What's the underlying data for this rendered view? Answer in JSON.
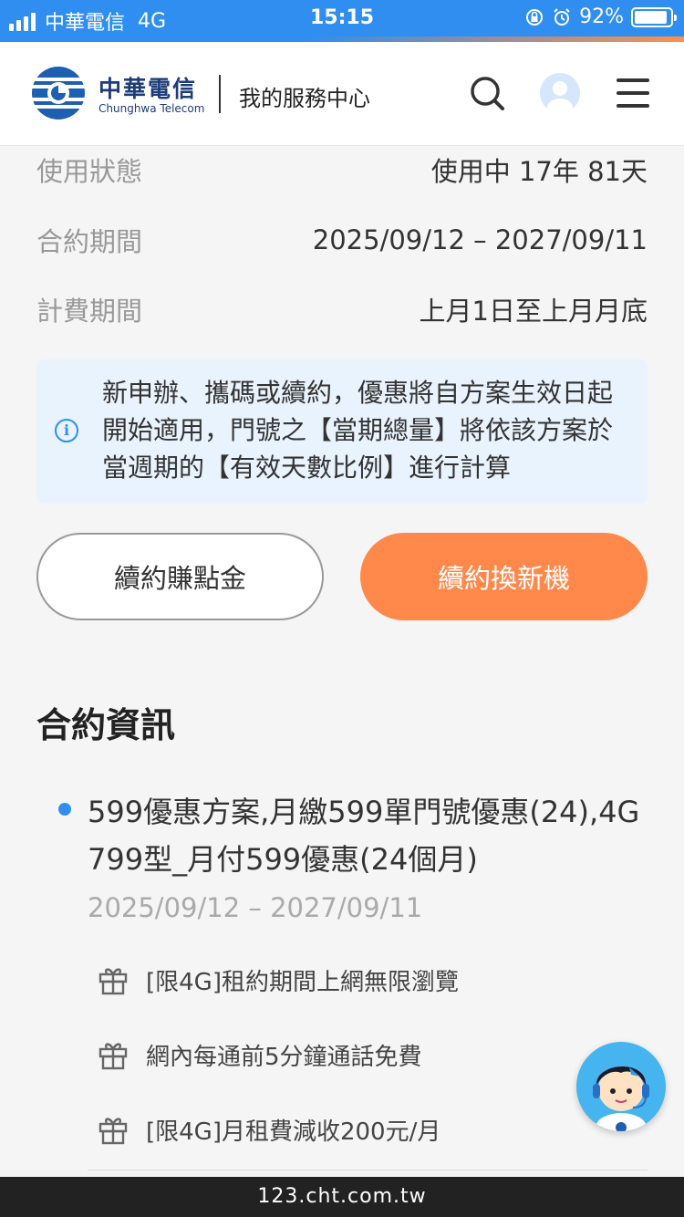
{
  "status_bar": {
    "carrier": "中華電信",
    "network": "4G",
    "time": "15:15",
    "battery": "92%",
    "battery_level": 0.92
  },
  "header": {
    "brand_zh": "中華電信",
    "brand_en": "Chunghwa Telecom",
    "title": "我的服務中心",
    "icons": [
      "search-icon",
      "avatar-icon",
      "menu-icon"
    ]
  },
  "details": [
    {
      "label": "使用狀態",
      "value": "使用中 17年 81天"
    },
    {
      "label": "合約期間",
      "value": "2025/09/12 – 2027/09/11"
    },
    {
      "label": "計費期間",
      "value": "上月1日至上月月底"
    }
  ],
  "notice": {
    "text": "新申辦、攜碼或續約，優惠將自方案生效日起開始適用，門號之【當期總量】將依該方案於當週期的【有效天數比例】進行計算"
  },
  "buttons": {
    "renew_points": "續約賺點金",
    "renew_phone": "續約換新機"
  },
  "contract": {
    "title": "合約資訊",
    "plan_name": "599優惠方案,月繳599單門號優惠(24),4G 799型_月付599優惠(24個月)",
    "plan_period": "2025/09/12 – 2027/09/11",
    "benefits": [
      "[限4G]租約期間上網無限瀏覽",
      "網內每通前5分鐘通話免費",
      "[限4G]月租費減收200元/月"
    ]
  },
  "url": "123.cht.com.tw",
  "colors": {
    "accent_blue": "#2f8ef0",
    "accent_orange": "#ff884a",
    "notice_bg": "#e9f3fd",
    "brand_navy": "#1d3c7a"
  }
}
